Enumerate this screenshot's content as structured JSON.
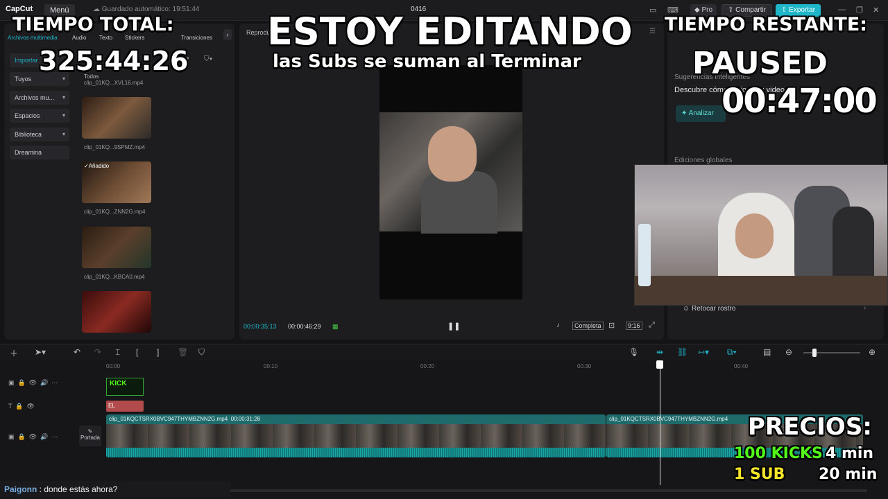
{
  "topbar": {
    "logo": "CapCut",
    "menu": "Menú",
    "autosave": "Guardado automático: 19:51:44",
    "project": "0416",
    "pro": "Pro",
    "share": "Compartir",
    "export": "Exportar"
  },
  "media": {
    "tabs": [
      "Archivos multimedia",
      "Audio",
      "Texto",
      "Stickers",
      "Transiciones"
    ],
    "side_items": [
      "Importar",
      "Tuyos",
      "Archivos mu...",
      "Espacios",
      "Biblioteca",
      "Dreamina"
    ],
    "filter_label": "Todos",
    "added_badge": "Añadido",
    "clips": [
      "clip_01KQ...XVL16.mp4",
      "clip_01KQ...9SPMZ.mp4",
      "clip_01KQ...ZNN2G.mp4",
      "clip_01KQ...KBCA0.mp4"
    ]
  },
  "player": {
    "title": "Reproductor",
    "current_time": "00:00:35:13",
    "total_time": "00:00:46:29",
    "quality": "Completa",
    "ratio": "9:16"
  },
  "rightpanel": {
    "suggestions": "Sugerencias inteligentes",
    "discover": "Descubre cómo mejorar tu video",
    "analyze": "Analizar",
    "global_edits": "Ediciones globales",
    "retouch": "Retocar rostro"
  },
  "timeline": {
    "ticks": [
      "00:00",
      "00:10",
      "00:20",
      "00:30",
      "00:40"
    ],
    "kick_clip": "KICK",
    "text_clip": "EL CONTADO",
    "cover": "Portada",
    "clip1_name": "clip_01KQCTSRX0BVC947THYMBZNN2G.mp4",
    "clip1_duration": "00:00:31:28",
    "clip2_name": "clip_01KQCTSRX0BVC947THYMBZNN2G.mp4"
  },
  "chat": {
    "user": "Paigonn",
    "message": " : donde estás ahora?"
  },
  "overlay": {
    "total_label": "TIEMPO TOTAL:",
    "total_value": "325:44:26",
    "headline": "ESTOY EDITANDO",
    "subline": "las Subs se suman al Terminar",
    "remaining_label": "TIEMPO RESTANTE:",
    "status": "PAUSED",
    "remaining_value": "00:47:00",
    "prices_label": "PRECIOS:",
    "price1_item": "100 KICKS",
    "price1_value": "4 min",
    "price2_item": "1 SUB",
    "price2_value": "20 min"
  },
  "colors": {
    "accent": "#1eb6c8",
    "kick_green": "#53fc18",
    "sub_yellow": "#f5e42a"
  }
}
